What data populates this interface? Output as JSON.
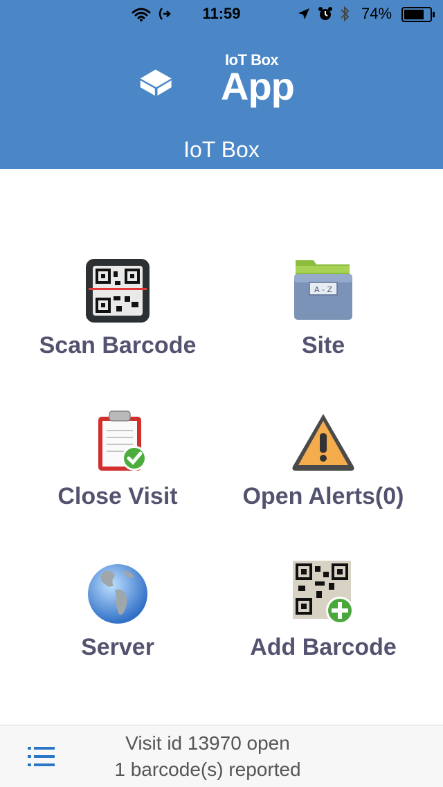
{
  "status_bar": {
    "time": "11:59",
    "battery_percent": "74%",
    "icons": [
      "wifi-icon",
      "hotspot-icon",
      "location-arrow-icon",
      "alarm-icon",
      "bluetooth-icon",
      "battery-icon"
    ]
  },
  "header": {
    "logo_small": "IoT Box",
    "logo_big": "App",
    "title": "IoT Box",
    "background_color": "#4b87c6"
  },
  "tiles": [
    {
      "label": "Scan Barcode",
      "icon": "qr-scanner-icon"
    },
    {
      "label": "Site",
      "icon": "file-drawer-icon"
    },
    {
      "label": "Close Visit",
      "icon": "clipboard-check-icon"
    },
    {
      "label": "Open Alerts(0)",
      "icon": "warning-icon"
    },
    {
      "label": "Server",
      "icon": "globe-icon"
    },
    {
      "label": "Add Barcode",
      "icon": "add-barcode-icon"
    }
  ],
  "footer": {
    "line1": "Visit id 13970 open",
    "line2": "1 barcode(s) reported",
    "menu_icon": "menu-list-icon"
  },
  "colors": {
    "label": "#535370",
    "accent": "#4b87c6"
  }
}
